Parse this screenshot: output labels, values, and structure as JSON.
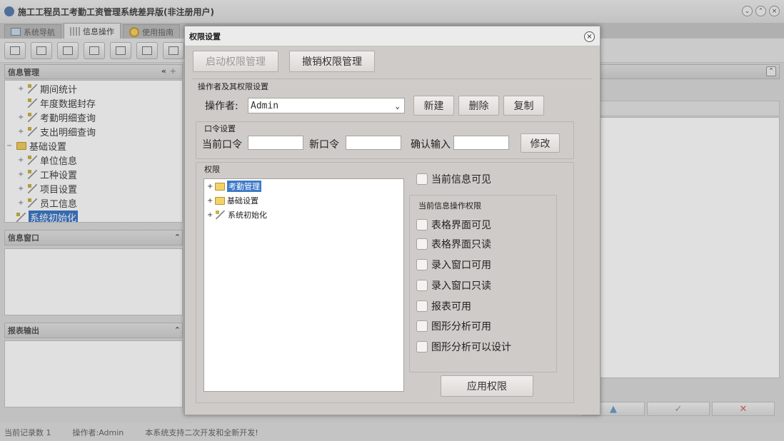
{
  "app": {
    "title": "施工工程员工考勤工资管理系统差异版(非注册用户)",
    "tabs": [
      {
        "label": "系统导航"
      },
      {
        "label": "信息操作"
      },
      {
        "label": "使用指南"
      }
    ]
  },
  "left_panel": {
    "header": "信息管理",
    "tree": [
      {
        "label": "期间统计"
      },
      {
        "label": "年度数据封存"
      },
      {
        "label": "考勤明细查询"
      },
      {
        "label": "支出明细查询"
      },
      {
        "label": "基础设置"
      },
      {
        "label": "单位信息"
      },
      {
        "label": "工种设置"
      },
      {
        "label": "项目设置"
      },
      {
        "label": "员工信息"
      },
      {
        "label": "系统初始化"
      }
    ],
    "info_window": "信息窗口",
    "report_output": "报表输出"
  },
  "status": {
    "record_count": "当前记录数 1",
    "operator": "操作者:Admin",
    "message": "本系统支持二次开发和全新开发!"
  },
  "dialog": {
    "title": "权限设置",
    "enable_btn": "启动权限管理",
    "revoke_btn": "撤销权限管理",
    "operator_group": "操作者及其权限设置",
    "operator_label": "操作者:",
    "operator_value": "Admin",
    "new_btn": "新建",
    "delete_btn": "删除",
    "copy_btn": "复制",
    "password_group": "口令设置",
    "current_pw": "当前口令",
    "new_pw": "新口令",
    "confirm_pw": "确认输入",
    "modify_btn": "修改",
    "perm_group": "权限",
    "perm_tree": [
      {
        "label": "考勤管理"
      },
      {
        "label": "基础设置"
      },
      {
        "label": "系统初始化"
      }
    ],
    "current_visible": "当前信息可见",
    "ops_group": "当前信息操作权限",
    "ops": [
      {
        "label": "表格界面可见"
      },
      {
        "label": "表格界面只读"
      },
      {
        "label": "录入窗口可用"
      },
      {
        "label": "录入窗口只读"
      },
      {
        "label": "报表可用"
      },
      {
        "label": "图形分析可用"
      },
      {
        "label": "图形分析可以设计"
      }
    ],
    "apply_btn": "应用权限"
  }
}
